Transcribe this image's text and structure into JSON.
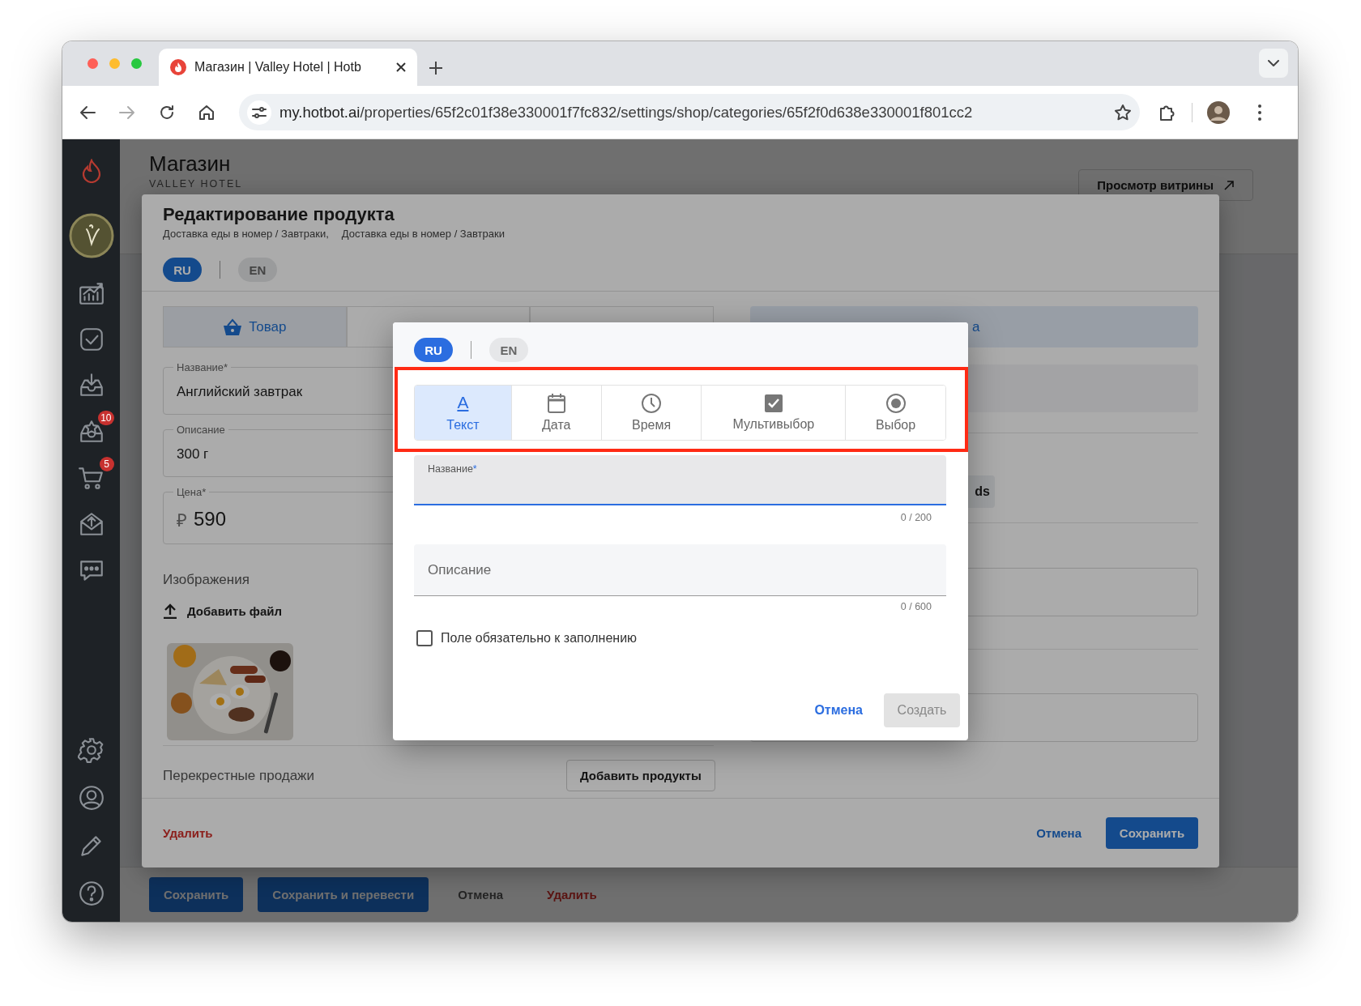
{
  "browser": {
    "tab_title": "Магазин | Valley Hotel | Hotb",
    "url_host": "my.hotbot.ai",
    "url_path": "/properties/65f2c01f38e330001f7fc832/settings/shop/categories/65f2f0d638e330001f801cc2"
  },
  "sidebar": {
    "top_items": [
      {
        "kind": "analytics"
      },
      {
        "kind": "tasks"
      },
      {
        "kind": "inbox"
      },
      {
        "kind": "reviews",
        "badge": "10"
      },
      {
        "kind": "cart",
        "badge": "5"
      },
      {
        "kind": "mail"
      },
      {
        "kind": "chat"
      }
    ],
    "bottom_items": [
      {
        "kind": "settings"
      },
      {
        "kind": "profile"
      },
      {
        "kind": "edit"
      },
      {
        "kind": "help"
      }
    ]
  },
  "page": {
    "title": "Магазин",
    "subtitle": "VALLEY HOTEL",
    "storefront_button": "Просмотр витрины"
  },
  "product_dialog": {
    "title": "Редактирование продукта",
    "breadcrumbs": [
      "Доставка еды в номер / Завтраки,",
      "Доставка еды в номер / Завтраки"
    ],
    "languages": [
      {
        "label": "RU",
        "selected": true
      },
      {
        "label": "EN",
        "selected": false
      }
    ],
    "tabs": [
      {
        "label": "Товар",
        "selected": true
      },
      {
        "selected": false
      },
      {
        "selected": false
      }
    ],
    "side_tab": {
      "label": "а",
      "selected": true
    },
    "fields": [
      {
        "label": "Название*",
        "value": "Английский завтрак"
      },
      {
        "label": "Описание",
        "value": "300 г"
      },
      {
        "label": "Цена*",
        "prefix": "₽",
        "value": "590"
      }
    ],
    "images_label": "Изображения",
    "add_file": "Добавить файл",
    "image": {
      "kind": "picture"
    },
    "cross_sell_label": "Перекрестные продажи",
    "add_products": "Добавить продукты",
    "side_button": "ds",
    "delete": "Удалить",
    "cancel": "Отмена",
    "save": "Сохранить"
  },
  "bottom_bar": {
    "buttons": [
      {
        "label": "Сохранить",
        "kind": "primary"
      },
      {
        "label": "Сохранить и перевести",
        "kind": "primary"
      },
      {
        "label": "Отмена",
        "kind": "plain"
      },
      {
        "label": "Удалить",
        "kind": "danger"
      }
    ]
  },
  "field_dialog": {
    "languages": [
      {
        "label": "RU",
        "selected": true
      },
      {
        "label": "EN",
        "selected": false
      }
    ],
    "types": [
      {
        "kind": "text",
        "icon_char": "A",
        "label": "Текст",
        "selected": true
      },
      {
        "kind": "date",
        "label": "Дата",
        "selected": false
      },
      {
        "kind": "time",
        "label": "Время",
        "selected": false
      },
      {
        "kind": "multiselect",
        "label": "Мультивыбор",
        "selected": false
      },
      {
        "kind": "select",
        "label": "Выбор",
        "selected": false
      }
    ],
    "name_field": {
      "label": "Название",
      "required_mark": "*",
      "counter": "0 / 200"
    },
    "description_field": {
      "placeholder": "Описание",
      "counter": "0 / 600"
    },
    "required_checkbox": {
      "label": "Поле обязательно к заполнению",
      "checked": false
    },
    "cancel": "Отмена",
    "create": {
      "label": "Создать",
      "disabled": true
    }
  }
}
